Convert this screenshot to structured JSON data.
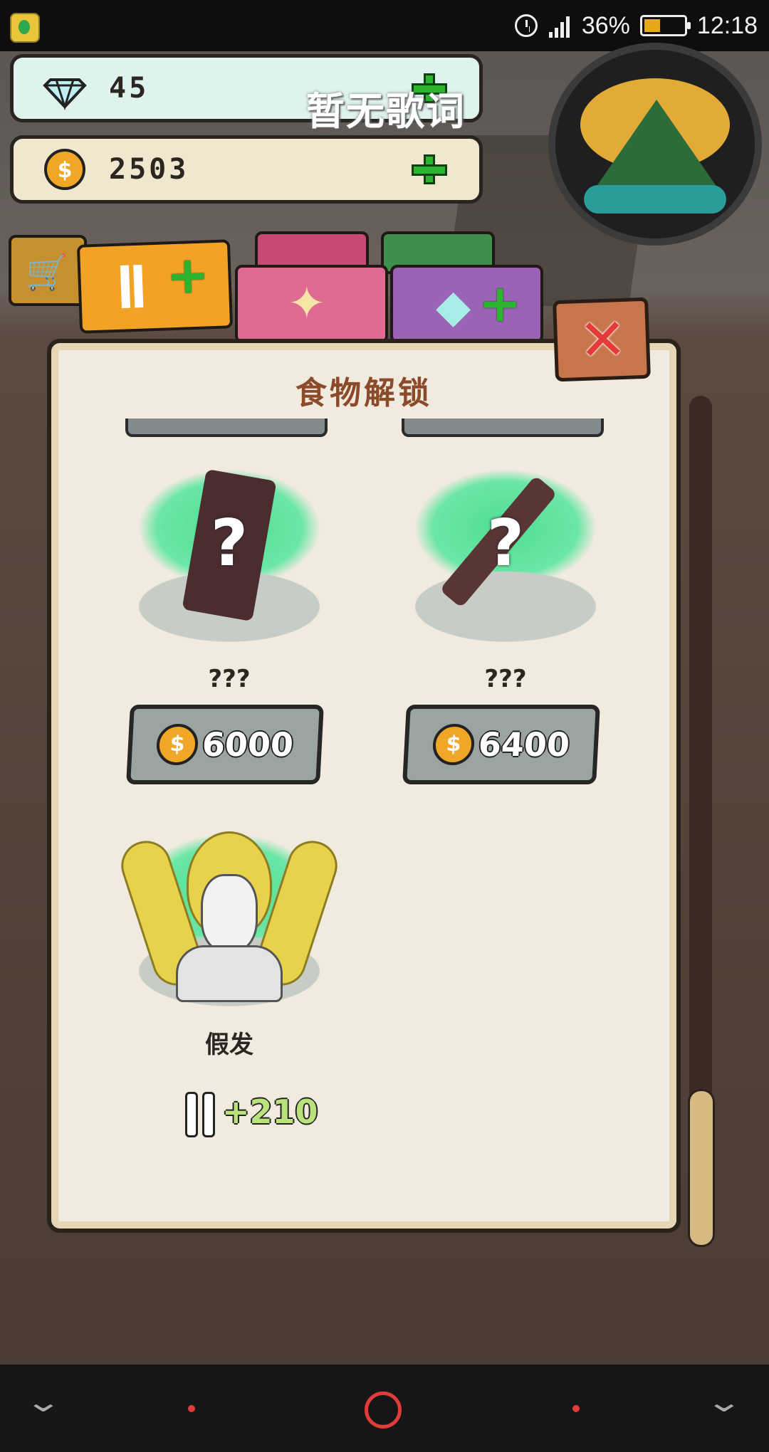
{
  "status_bar": {
    "battery": "36%",
    "time": "12:18",
    "battery_level": 0.36,
    "icons": [
      "music-app-icon",
      "alarm-icon",
      "signal-icon",
      "battery-icon"
    ]
  },
  "currency": {
    "diamonds": "45",
    "coins": "2503"
  },
  "overlay": {
    "lyrics": "暂无歌词"
  },
  "tabs": [
    {
      "name": "food",
      "icon": "fork-knife-plus-icon",
      "active": true
    },
    {
      "name": "skill",
      "icon": "sparkle-gem-icon",
      "active": false
    },
    {
      "name": "gem",
      "icon": "coin-diamond-plus-icon",
      "active": false
    }
  ],
  "panel": {
    "title": "食物解锁"
  },
  "items": [
    {
      "name": "???",
      "price": "6000",
      "coin_symbol": "$",
      "locked": true
    },
    {
      "name": "???",
      "price": "6400",
      "coin_symbol": "$",
      "locked": true
    },
    {
      "name": "假发",
      "reward": "+210",
      "locked": false
    }
  ],
  "colors": {
    "accent_green": "#2bb52e",
    "coin_gold": "#f0a626",
    "title_brown": "#8b4b2a",
    "close_red": "#e53a3a"
  }
}
